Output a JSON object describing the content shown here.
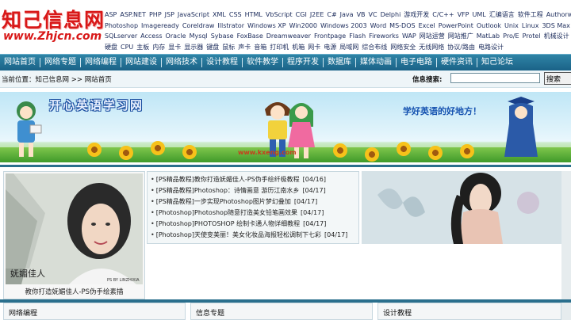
{
  "logo": {
    "name": "知己信息网",
    "url": "www.Zhjcn.com"
  },
  "keywords": [
    [
      "ASP",
      "ASP.NET",
      "PHP",
      "JSP",
      "JavaScript",
      "XML",
      "CSS",
      "HTML",
      "VbScript",
      "CGI",
      "J2EE",
      "C#",
      "Java",
      "VB",
      "VC",
      "Delphi",
      "游戏开发",
      "C/C++",
      "VFP",
      "UML",
      "汇编语言",
      "软件工程",
      "Authorware"
    ],
    [
      "Photoshop",
      "Imageready",
      "Coreldraw",
      "Illstrator",
      "Windows XP",
      "Win2000",
      "Windows 2003",
      "Word",
      "MS-DOS",
      "Excel",
      "PowerPoint",
      "Outlook",
      "Unix",
      "Linux",
      "3DS Max"
    ],
    [
      "SQLserver",
      "Access",
      "Oracle",
      "Mysql",
      "Sybase",
      "FoxBase",
      "Dreamweaver",
      "Frontpage",
      "Flash",
      "Fireworks",
      "WAP",
      "网站运营",
      "网站推广",
      "MatLab",
      "Pro/E",
      "Protel",
      "机械设计"
    ],
    [
      "硬盘",
      "CPU",
      "主板",
      "内存",
      "显卡",
      "显示器",
      "键盘",
      "鼠标",
      "声卡",
      "音箱",
      "打印机",
      "机箱",
      "网卡",
      "电源",
      "局域网",
      "综合布线",
      "网络安全",
      "无线网络",
      "协议/路由",
      "电路设计"
    ]
  ],
  "nav": [
    "网站首页",
    "网络专题",
    "网络编程",
    "网站建设",
    "网络技术",
    "设计教程",
    "软件教学",
    "程序开发",
    "数据库",
    "媒体动画",
    "电子电路",
    "硬件资讯",
    "知己论坛"
  ],
  "location": {
    "label": "当前位置：",
    "site": "知己信息网",
    "sep": ">>",
    "page": "网站首页"
  },
  "search": {
    "label": "信息搜索:",
    "placeholder": "",
    "button": "搜索"
  },
  "banner": {
    "title": "开心英语学习网",
    "slogan": "学好英语的好地方！",
    "url": "www.kxeng.com"
  },
  "feature": {
    "caption": "教你打造妩媚佳人-PS伪手绘素描",
    "photo_text": "妩媚佳人",
    "photo_small": "PS BY LINZHIXIA",
    "items": [
      {
        "title": "[PS精品教程]教你打造妩媚佳人-PS伪手绘纤极教程",
        "date": "[04/16]"
      },
      {
        "title": "[PS精品教程]Photoshop：诗情画意 游历江南水乡",
        "date": "[04/17]"
      },
      {
        "title": "[PS精品教程]一步实现Photoshop图片梦幻叠加",
        "date": "[04/17]"
      },
      {
        "title": "[Photoshop]Photoshop随意打造美女铅笔画效果",
        "date": "[04/17]"
      },
      {
        "title": "[Photoshop]PHOTOSHOP 绘制卡通人物详细教程",
        "date": "[04/17]"
      },
      {
        "title": "[Photoshop]天使变美丽！美女化妆品海报轻松调制下七彩",
        "date": "[04/17]"
      }
    ]
  },
  "panels": [
    "网络编程",
    "信息专题",
    "设计教程"
  ],
  "colors": {
    "nav": "#1f6e92",
    "brand": "#d81818",
    "divider": "#2a6f8d"
  }
}
